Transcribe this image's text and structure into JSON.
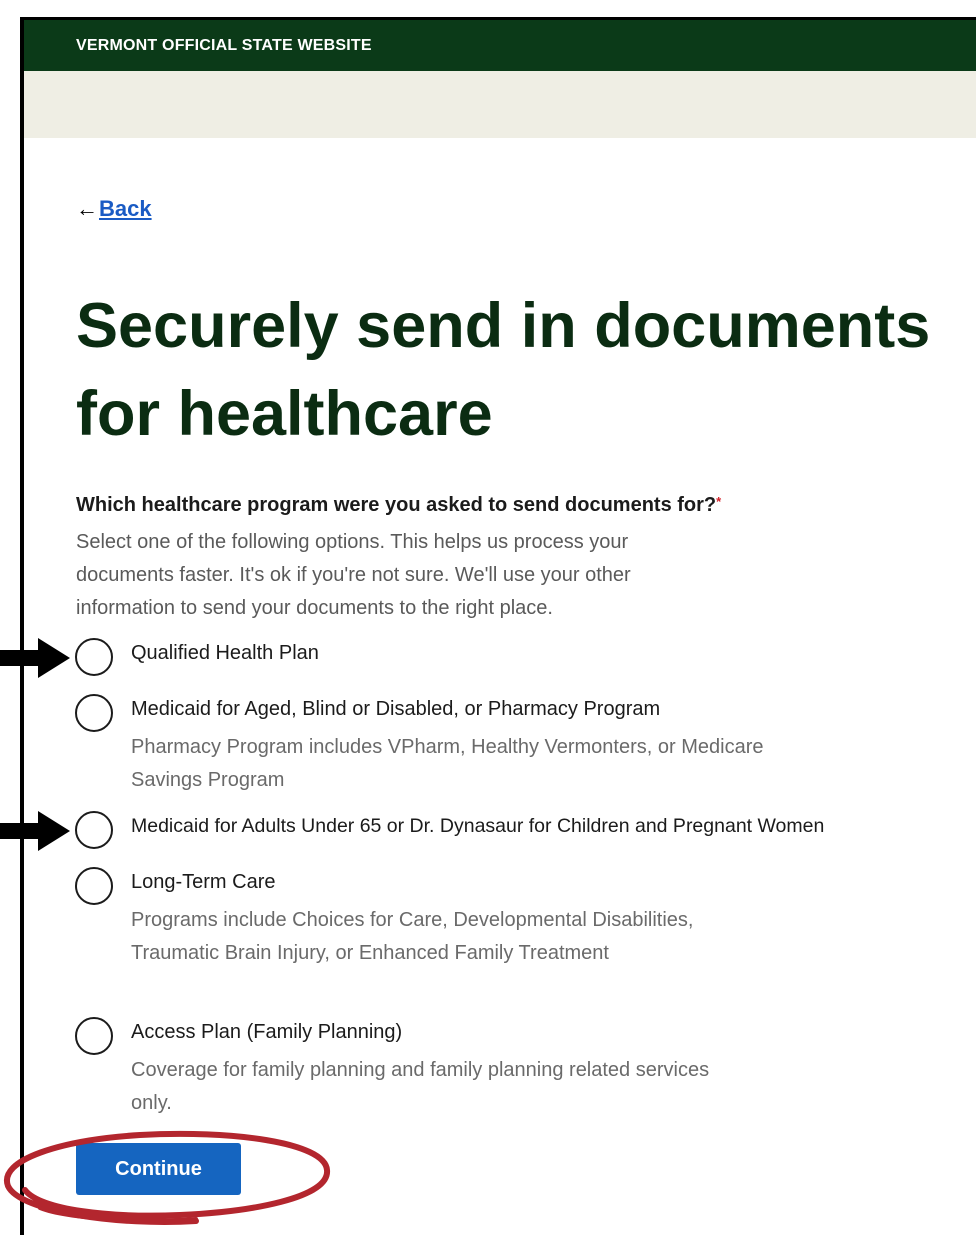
{
  "banner": {
    "text": "VERMONT OFFICIAL STATE WEBSITE"
  },
  "nav": {
    "back_label": "Back"
  },
  "page": {
    "title": "Securely send in documents for healthcare"
  },
  "form": {
    "question": "Which healthcare program were you asked to send documents for?",
    "required_marker": "*",
    "hint": "Select one of the following options. This helps us process your documents faster. It's ok if you're not sure. We'll use your other information to send your documents to the right place.",
    "options": [
      {
        "label": "Qualified Health Plan",
        "description": ""
      },
      {
        "label": "Medicaid for Aged, Blind or Disabled, or Pharmacy Program",
        "description": "Pharmacy Program includes VPharm, Healthy Vermonters, or Medicare Savings Program"
      },
      {
        "label": "Medicaid for Adults Under 65 or Dr. Dynasaur for Children and Pregnant Women",
        "description": ""
      },
      {
        "label": "Long-Term Care",
        "description": "Programs include Choices for Care, Developmental Disabilities, Traumatic Brain Injury, or Enhanced Family Treatment"
      },
      {
        "label": "Access Plan (Family Planning)",
        "description": "Coverage for family planning and family planning related services only."
      }
    ],
    "continue_label": "Continue"
  },
  "annotations": {
    "arrow_color": "#000000",
    "circle_color": "#b3262e",
    "arrowed_options": [
      0,
      2
    ]
  },
  "colors": {
    "banner_bg": "#0b3a18",
    "heading": "#0b2c12",
    "link": "#1a5bc4",
    "button": "#1565c0"
  }
}
